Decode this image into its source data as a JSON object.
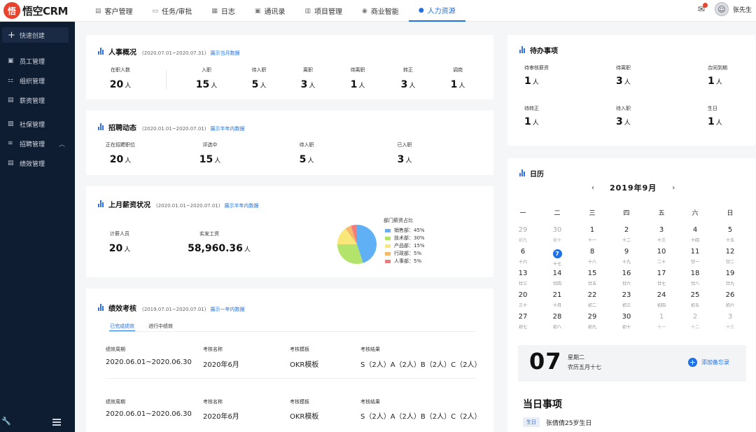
{
  "app": {
    "logo_char": "悟",
    "name": "悟空CRM"
  },
  "nav": [
    {
      "label": "客户管理",
      "icon": "customer-icon",
      "active": false
    },
    {
      "label": "任务/审批",
      "icon": "task-icon",
      "active": false
    },
    {
      "label": "日志",
      "icon": "log-icon",
      "active": false
    },
    {
      "label": "通讯录",
      "icon": "contacts-icon",
      "active": false
    },
    {
      "label": "项目管理",
      "icon": "project-icon",
      "active": false
    },
    {
      "label": "商业智能",
      "icon": "bi-icon",
      "active": false
    },
    {
      "label": "人力资源",
      "icon": "person-icon",
      "active": true
    }
  ],
  "user": {
    "name": "张先生"
  },
  "sidebar": {
    "quick_create": "快速创建",
    "items": [
      {
        "label": "员工管理",
        "icon": "employee-icon"
      },
      {
        "label": "组织管理",
        "icon": "org-icon"
      },
      {
        "label": "薪资管理",
        "icon": "salary-icon"
      },
      {
        "label": "社保管理",
        "icon": "insurance-icon"
      },
      {
        "label": "招聘管理",
        "icon": "recruit-icon",
        "expandable": true
      },
      {
        "label": "绩效管理",
        "icon": "performance-icon"
      }
    ]
  },
  "hr_overview": {
    "title": "人事概况",
    "range": "(2020.07.01~2020.07.31)",
    "link": "展示当月数据",
    "unit": "人",
    "stats": [
      {
        "label": "在职人数",
        "value": "20"
      },
      {
        "label": "入职",
        "value": "15"
      },
      {
        "label": "待入职",
        "value": "5"
      },
      {
        "label": "离职",
        "value": "3"
      },
      {
        "label": "待离职",
        "value": "1"
      },
      {
        "label": "转正",
        "value": "3"
      },
      {
        "label": "调岗",
        "value": "1"
      }
    ]
  },
  "recruitment": {
    "title": "招聘动态",
    "range": "(2020.01.01~2020.07.01)",
    "link": "展示半年内数据",
    "unit": "人",
    "stats": [
      {
        "label": "正在招聘职位",
        "value": "20"
      },
      {
        "label": "评选中",
        "value": "15"
      },
      {
        "label": "待入职",
        "value": "5"
      },
      {
        "label": "已入职",
        "value": "3"
      }
    ]
  },
  "salary": {
    "title": "上月薪资状况",
    "range": "(2020.01.01~2020.07.01)",
    "link": "展示半年内数据",
    "payroll_label": "计薪人员",
    "payroll_value": "20",
    "payroll_unit": "人",
    "actual_label": "实发工资",
    "actual_value": "58,960.36",
    "actual_unit": "人",
    "chart_title": "部门薪资占比"
  },
  "chart_data": {
    "type": "pie",
    "title": "部门薪资占比",
    "categories": [
      "销售部",
      "技术部",
      "产品部",
      "行政部",
      "人事部"
    ],
    "values": [
      45,
      30,
      15,
      5,
      5
    ],
    "display_labels": [
      "销售部：45%",
      "技术部：30%",
      "产品部：15%",
      "行政部：5%",
      "人事部：5%"
    ],
    "colors": [
      "#5fb0f4",
      "#b3e36a",
      "#f9e77a",
      "#f7b86b",
      "#f27b7b"
    ],
    "legend": "right"
  },
  "performance": {
    "title": "绩效考核",
    "range": "(2019.07.01~2020.07.01)",
    "link": "展示一年内数据",
    "tabs": [
      "已完成绩效",
      "进行中绩效"
    ],
    "col_labels": [
      "绩效周期",
      "考核名称",
      "考核模板",
      "考核结果"
    ],
    "rows": [
      {
        "period": "2020.06.01~2020.06.30",
        "name": "2020年6月",
        "template": "OKR模板",
        "result": "S（2人）A（2人）B（2人）C（2人）"
      },
      {
        "period": "2020.06.01~2020.06.30",
        "name": "2020年6月",
        "template": "OKR模板",
        "result": "S（2人）A（2人）B（2人）C（2人）"
      }
    ]
  },
  "todo": {
    "title": "待办事项",
    "unit": "人",
    "items": [
      {
        "label": "待审核薪资",
        "value": "1"
      },
      {
        "label": "待离职",
        "value": "3"
      },
      {
        "label": "合同到期",
        "value": "1"
      },
      {
        "label": "待转正",
        "value": "1"
      },
      {
        "label": "待入职",
        "value": "3"
      },
      {
        "label": "生日",
        "value": "1"
      }
    ]
  },
  "calendar": {
    "title": "日历",
    "month_label": "2019年9月",
    "weekdays": [
      "一",
      "二",
      "三",
      "四",
      "五",
      "六",
      "日"
    ],
    "days": [
      {
        "d": "29",
        "l": "初九",
        "dim": true
      },
      {
        "d": "30",
        "l": "初十",
        "dim": true
      },
      {
        "d": "1",
        "l": "十一"
      },
      {
        "d": "2",
        "l": "十二"
      },
      {
        "d": "3",
        "l": "十三"
      },
      {
        "d": "4",
        "l": "十四"
      },
      {
        "d": "5",
        "l": "十五"
      },
      {
        "d": "6",
        "l": "十六"
      },
      {
        "d": "7",
        "l": "十七",
        "today": true
      },
      {
        "d": "8",
        "l": "十八"
      },
      {
        "d": "9",
        "l": "十九"
      },
      {
        "d": "10",
        "l": "二十"
      },
      {
        "d": "11",
        "l": "廿一"
      },
      {
        "d": "12",
        "l": "廿二"
      },
      {
        "d": "13",
        "l": "廿三"
      },
      {
        "d": "14",
        "l": "廿四"
      },
      {
        "d": "15",
        "l": "廿五"
      },
      {
        "d": "16",
        "l": "廿六"
      },
      {
        "d": "17",
        "l": "廿七"
      },
      {
        "d": "18",
        "l": "廿八"
      },
      {
        "d": "19",
        "l": "廿九"
      },
      {
        "d": "20",
        "l": "三十"
      },
      {
        "d": "21",
        "l": "十月"
      },
      {
        "d": "22",
        "l": "初二"
      },
      {
        "d": "23",
        "l": "初三"
      },
      {
        "d": "24",
        "l": "初四"
      },
      {
        "d": "25",
        "l": "初五"
      },
      {
        "d": "26",
        "l": "初六"
      },
      {
        "d": "27",
        "l": "初七"
      },
      {
        "d": "28",
        "l": "初八"
      },
      {
        "d": "29",
        "l": "初九"
      },
      {
        "d": "30",
        "l": "初十"
      },
      {
        "d": "1",
        "l": "十一",
        "dim": true
      },
      {
        "d": "2",
        "l": "十二",
        "dim": true
      },
      {
        "d": "3",
        "l": "十三",
        "dim": true
      }
    ],
    "today": {
      "day": "07",
      "weekday": "星期二",
      "lunar": "农历五月十七",
      "add_memo": "添加备忘录"
    },
    "events_title": "当日事项",
    "events": [
      {
        "tag": "生日",
        "text": "张倩倩25岁生日"
      }
    ]
  }
}
